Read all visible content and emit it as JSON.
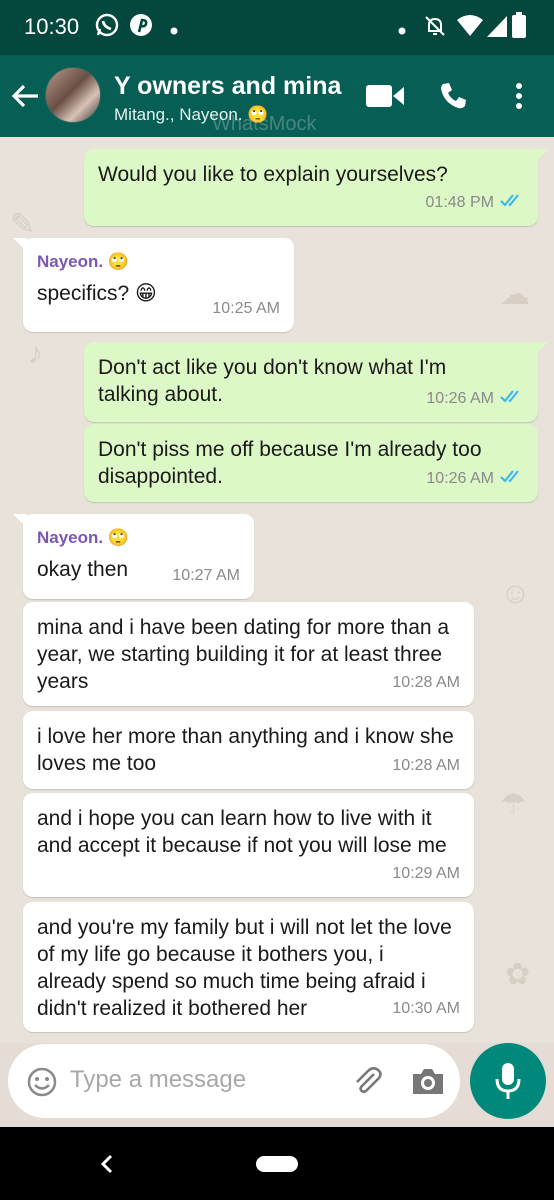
{
  "status_bar": {
    "time": "10:30",
    "left_icons": [
      "whatsapp-icon",
      "pinterest-icon",
      "dot-icon"
    ],
    "right_icons": [
      "dot-icon",
      "notifications-off-icon",
      "wifi-icon",
      "signal-icon",
      "battery-icon"
    ]
  },
  "header": {
    "title": "Y owners and mina",
    "subtitle": "Mitang., Nayeon. 🙄",
    "watermark": "WhatsMock",
    "icons": [
      "back-arrow-icon",
      "video-call-icon",
      "phone-icon",
      "more-vert-icon"
    ],
    "color": "#075e54"
  },
  "messages": [
    {
      "direction": "out",
      "text": "Would you like to explain yourselves?",
      "time": "01:48 PM",
      "read": true
    },
    {
      "direction": "in",
      "sender": "Nayeon. 🙄",
      "text": "specifics? 😁",
      "time": "10:25 AM"
    },
    {
      "direction": "out",
      "text": "Don't act like you don't know what I'm talking about.",
      "time": "10:26 AM",
      "read": true
    },
    {
      "direction": "out",
      "text": "Don't piss me off because I'm already too disappointed.",
      "time": "10:26 AM",
      "read": true
    },
    {
      "direction": "in",
      "sender": "Nayeon. 🙄",
      "text": "okay then",
      "time": "10:27 AM"
    },
    {
      "direction": "in",
      "text": "mina and i have been dating for more than a year, we starting building it for at least three years",
      "time": "10:28 AM"
    },
    {
      "direction": "in",
      "text": "i love her more than anything and i know she loves me too",
      "time": "10:28 AM"
    },
    {
      "direction": "in",
      "text": "and i hope you can learn how to live with it and accept it because if not you will lose me",
      "time": "10:29 AM"
    },
    {
      "direction": "in",
      "text": "and you're my family but i will not let the love of my life go because it bothers you, i already spend so much time being afraid i didn't realized it bothered her",
      "time": "10:30 AM"
    }
  ],
  "composer": {
    "placeholder": "Type a message",
    "icons": [
      "emoji-icon",
      "attach-icon",
      "camera-icon",
      "mic-icon"
    ]
  },
  "colors": {
    "outgoing_bubble": "#dcf8c6",
    "incoming_bubble": "#ffffff",
    "sender_name": "#7a57b5",
    "read_ticks": "#34b7f1",
    "mic_button": "#00897b"
  }
}
